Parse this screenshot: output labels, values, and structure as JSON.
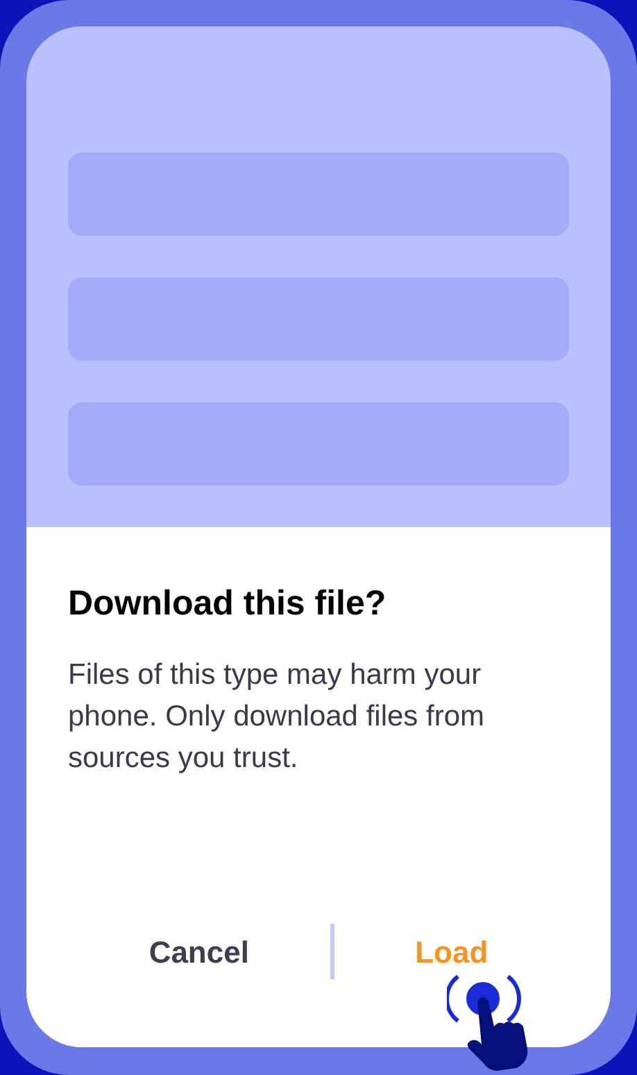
{
  "dialog": {
    "title": "Download this file?",
    "message": "Files of this type may harm your phone. Only download files from sources you trust."
  },
  "buttons": [
    {
      "label": "Cancel",
      "kind": "cancel"
    },
    {
      "label": "Load",
      "kind": "confirm"
    }
  ]
}
